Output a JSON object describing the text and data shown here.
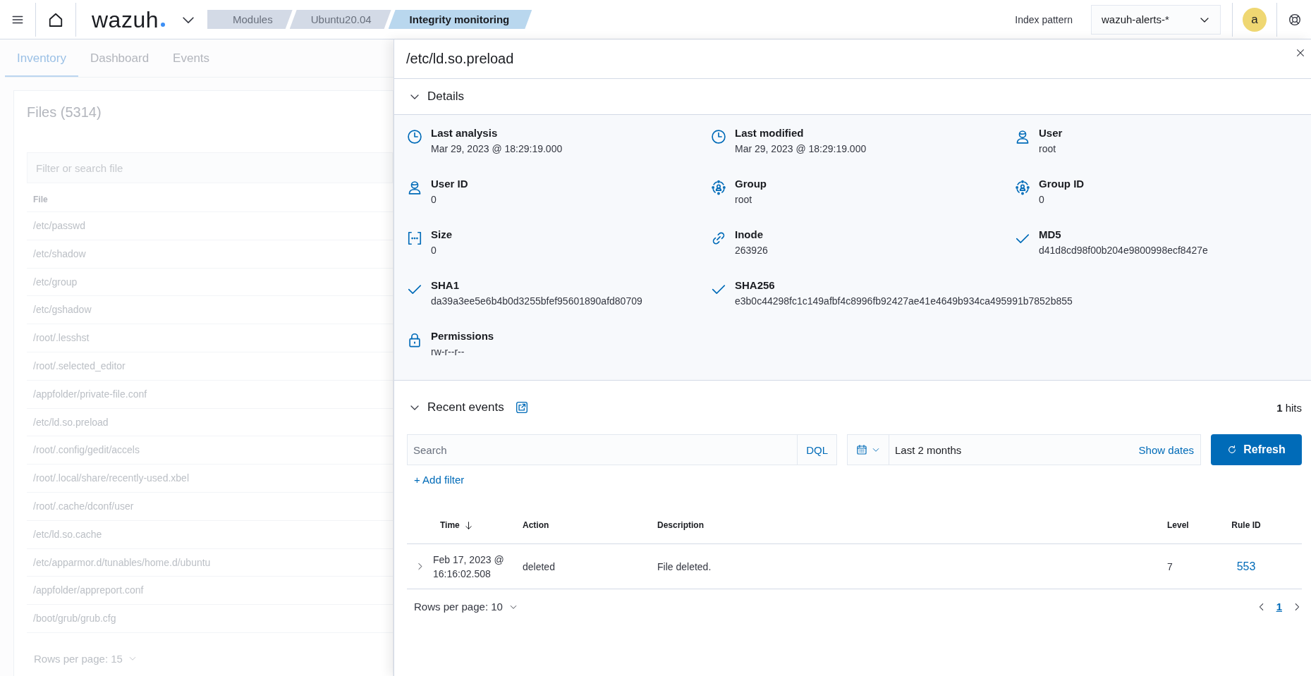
{
  "top_bar": {
    "logo": "wazuh",
    "breadcrumbs": [
      {
        "label": "Modules",
        "selected": false
      },
      {
        "label": "Ubuntu20.04",
        "selected": false
      },
      {
        "label": "Integrity monitoring",
        "selected": true
      }
    ],
    "index_pattern_label": "Index pattern",
    "index_pattern": "wazuh-alerts-*",
    "avatar": "a"
  },
  "tabs": [
    {
      "label": "Inventory",
      "selected": true
    },
    {
      "label": "Dashboard",
      "selected": false
    },
    {
      "label": "Events",
      "selected": false
    }
  ],
  "files_panel": {
    "title": "Files (5314)",
    "search": {
      "placeholder": "Filter or search file"
    },
    "column": "File",
    "rows": [
      "/etc/passwd",
      "/etc/shadow",
      "/etc/group",
      "/etc/gshadow",
      "/root/.lesshst",
      "/root/.selected_editor",
      "/appfolder/private-file.conf",
      "/etc/ld.so.preload",
      "/root/.config/gedit/accels",
      "/root/.local/share/recently-used.xbel",
      "/root/.cache/dconf/user",
      "/etc/ld.so.cache",
      "/etc/apparmor.d/tunables/home.d/ubuntu",
      "/appfolder/appreport.conf",
      "/boot/grub/grub.cfg"
    ],
    "rows_per_page": "Rows per page: 15"
  },
  "flyout": {
    "title": "/etc/ld.so.preload",
    "details": {
      "title": "Details",
      "expanded": true,
      "fields": [
        {
          "kind": "time",
          "label": "Last analysis",
          "value": "Mar 29, 2023 @ 18:29:19.000"
        },
        {
          "kind": "time",
          "label": "Last modified",
          "value": "Mar 29, 2023 @ 18:29:19.000"
        },
        {
          "kind": "user",
          "label": "User",
          "value": "root"
        },
        {
          "kind": "user",
          "label": "User ID",
          "value": "0"
        },
        {
          "kind": "group",
          "label": "Group",
          "value": "root"
        },
        {
          "kind": "group",
          "label": "Group ID",
          "value": "0"
        },
        {
          "kind": "size",
          "label": "Size",
          "value": "0"
        },
        {
          "kind": "link",
          "label": "Inode",
          "value": "263926"
        },
        {
          "kind": "hash",
          "label": "MD5",
          "value": "d41d8cd98f00b204e9800998ecf8427e"
        },
        {
          "kind": "hash",
          "label": "SHA1",
          "value": "da39a3ee5e6b4b0d3255bfef95601890afd80709"
        },
        {
          "kind": "hash",
          "wide": true,
          "label": "SHA256",
          "value": "e3b0c44298fc1c149afbf4c8996fb92427ae41e4649b934ca495991b7852b855"
        },
        {
          "kind": "lock",
          "label": "Permissions",
          "value": "rw-r--r--"
        }
      ]
    },
    "recent_events": {
      "title": "Recent events",
      "expanded": true,
      "hits_count": "1",
      "hits_label": "hits",
      "search": {
        "placeholder": "Search"
      },
      "query_language": "DQL",
      "time_range": "Last 2 months",
      "show_dates": "Show dates",
      "refresh": "Refresh",
      "add_filter": "+ Add filter",
      "table": {
        "columns": [
          {
            "label": "Time",
            "sorted": true
          },
          {
            "label": "Action"
          },
          {
            "label": "Description"
          },
          {
            "label": "Level"
          },
          {
            "label": "Rule ID"
          }
        ],
        "rows": [
          {
            "expanded": false,
            "cells": [
              "Feb 17, 2023 @ 16:16:02.508",
              "deleted",
              "File deleted.",
              "7",
              "553"
            ]
          }
        ]
      },
      "rows_per_page": "Rows per page: 10",
      "pages": [
        {
          "label": "1",
          "selected": true
        }
      ]
    }
  }
}
